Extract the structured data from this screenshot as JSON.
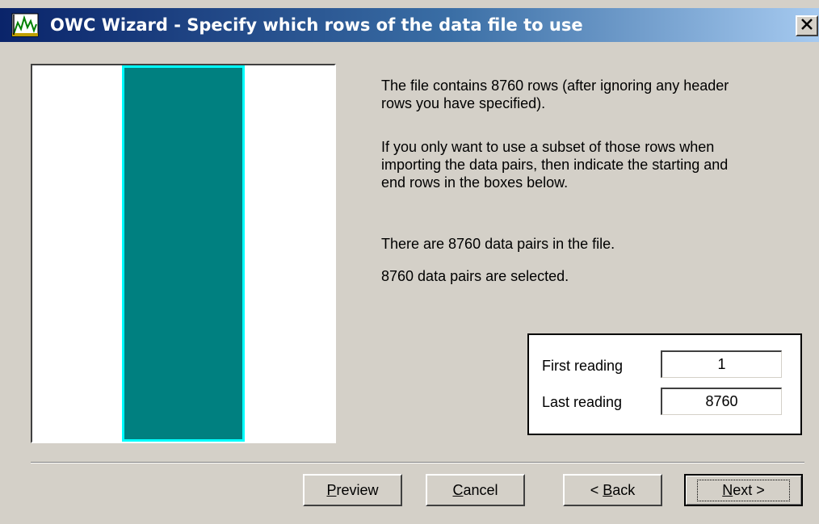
{
  "window": {
    "title": "OWC Wizard - Specify which rows of the data file to use",
    "title_icon": "chart-icon",
    "close_icon": "close-icon"
  },
  "preview_panel": {
    "background_color": "#ffffff",
    "bar_color": "#008080",
    "bar_border_color": "#00ffff"
  },
  "info": {
    "line1": "The file contains 8760 rows (after ignoring any header rows you have specified).",
    "line2": "If you only want to use a subset of those rows when importing the data pairs, then indicate the starting and end rows in the boxes below.",
    "line3": "There are 8760 data pairs in the file.",
    "line4": "8760 data pairs are selected."
  },
  "readings": {
    "first_label": "First reading",
    "first_value": "1",
    "last_label": "Last reading",
    "last_value": "8760"
  },
  "buttons": {
    "preview": {
      "accel": "P",
      "rest": "review"
    },
    "cancel": {
      "accel": "C",
      "rest": "ancel"
    },
    "back": {
      "prefix": "< ",
      "accel": "B",
      "rest": "ack"
    },
    "next": {
      "accel": "N",
      "rest": "ext >"
    }
  },
  "colors": {
    "titlebar_start": "#0a246a",
    "titlebar_end": "#a6caf0",
    "dialog_face": "#d4d0c8"
  }
}
